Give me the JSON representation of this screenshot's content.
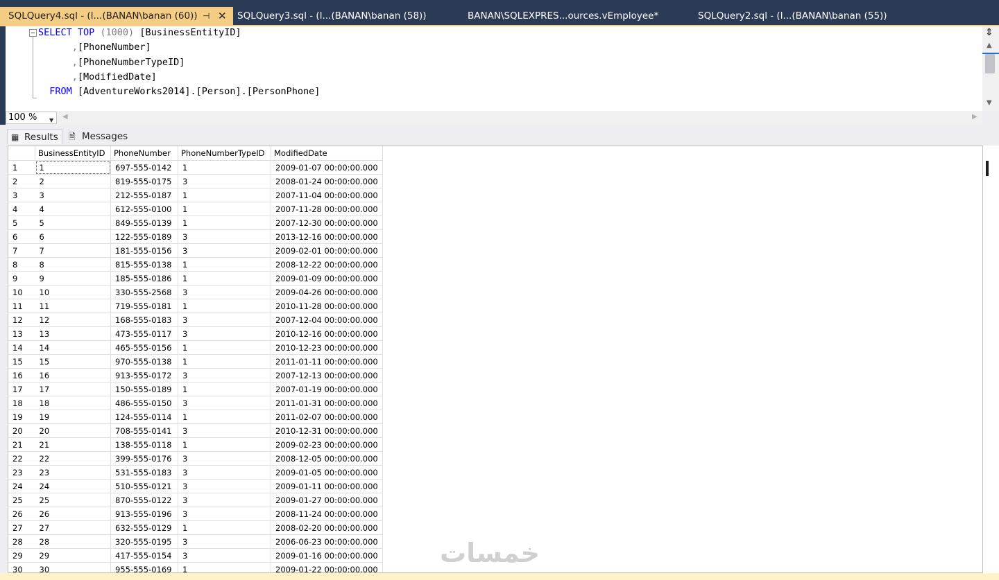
{
  "tabs": [
    {
      "label": "SQLQuery4.sql - (l...(BANAN\\banan (60))",
      "active": true
    },
    {
      "label": "SQLQuery3.sql - (l...(BANAN\\banan (58))"
    },
    {
      "label": "BANAN\\SQLEXPRES...ources.vEmployee*"
    },
    {
      "label": "SQLQuery2.sql - (l...(BANAN\\banan (55))"
    }
  ],
  "tab_pin_glyph": "⊣",
  "tab_close_glyph": "✕",
  "editor": {
    "line1_kw": "SELECT TOP",
    "line1_num": "(1000)",
    "line1_rest": "[BusinessEntityID]",
    "line2": "[PhoneNumber]",
    "line3": "[PhoneNumberTypeID]",
    "line4": "[ModifiedDate]",
    "line5_kw": "FROM",
    "line5_rest": "[AdventureWorks2014].[Person].[PersonPhone]"
  },
  "zoom": "100 %",
  "results_tabs": {
    "results": "Results",
    "messages": "Messages"
  },
  "grid": {
    "columns": [
      "BusinessEntityID",
      "PhoneNumber",
      "PhoneNumberTypeID",
      "ModifiedDate"
    ],
    "rows": [
      [
        "1",
        "697-555-0142",
        "1",
        "2009-01-07 00:00:00.000"
      ],
      [
        "2",
        "819-555-0175",
        "3",
        "2008-01-24 00:00:00.000"
      ],
      [
        "3",
        "212-555-0187",
        "1",
        "2007-11-04 00:00:00.000"
      ],
      [
        "4",
        "612-555-0100",
        "1",
        "2007-11-28 00:00:00.000"
      ],
      [
        "5",
        "849-555-0139",
        "1",
        "2007-12-30 00:00:00.000"
      ],
      [
        "6",
        "122-555-0189",
        "3",
        "2013-12-16 00:00:00.000"
      ],
      [
        "7",
        "181-555-0156",
        "3",
        "2009-02-01 00:00:00.000"
      ],
      [
        "8",
        "815-555-0138",
        "1",
        "2008-12-22 00:00:00.000"
      ],
      [
        "9",
        "185-555-0186",
        "1",
        "2009-01-09 00:00:00.000"
      ],
      [
        "10",
        "330-555-2568",
        "3",
        "2009-04-26 00:00:00.000"
      ],
      [
        "11",
        "719-555-0181",
        "1",
        "2010-11-28 00:00:00.000"
      ],
      [
        "12",
        "168-555-0183",
        "3",
        "2007-12-04 00:00:00.000"
      ],
      [
        "13",
        "473-555-0117",
        "3",
        "2010-12-16 00:00:00.000"
      ],
      [
        "14",
        "465-555-0156",
        "1",
        "2010-12-23 00:00:00.000"
      ],
      [
        "15",
        "970-555-0138",
        "1",
        "2011-01-11 00:00:00.000"
      ],
      [
        "16",
        "913-555-0172",
        "3",
        "2007-12-13 00:00:00.000"
      ],
      [
        "17",
        "150-555-0189",
        "1",
        "2007-01-19 00:00:00.000"
      ],
      [
        "18",
        "486-555-0150",
        "3",
        "2011-01-31 00:00:00.000"
      ],
      [
        "19",
        "124-555-0114",
        "1",
        "2011-02-07 00:00:00.000"
      ],
      [
        "20",
        "708-555-0141",
        "3",
        "2010-12-31 00:00:00.000"
      ],
      [
        "21",
        "138-555-0118",
        "1",
        "2009-02-23 00:00:00.000"
      ],
      [
        "22",
        "399-555-0176",
        "3",
        "2008-12-05 00:00:00.000"
      ],
      [
        "23",
        "531-555-0183",
        "3",
        "2009-01-05 00:00:00.000"
      ],
      [
        "24",
        "510-555-0121",
        "3",
        "2009-01-11 00:00:00.000"
      ],
      [
        "25",
        "870-555-0122",
        "3",
        "2009-01-27 00:00:00.000"
      ],
      [
        "26",
        "913-555-0196",
        "3",
        "2008-11-24 00:00:00.000"
      ],
      [
        "27",
        "632-555-0129",
        "1",
        "2008-02-20 00:00:00.000"
      ],
      [
        "28",
        "320-555-0195",
        "3",
        "2006-06-23 00:00:00.000"
      ],
      [
        "29",
        "417-555-0154",
        "3",
        "2009-01-16 00:00:00.000"
      ],
      [
        "30",
        "955-555-0169",
        "1",
        "2009-01-22 00:00:00.000"
      ]
    ]
  },
  "watermark": "خمسات",
  "colors": {
    "tab_active": "#f5cc84",
    "tab_bar": "#2b3a55",
    "keyword": "#0000ff"
  }
}
